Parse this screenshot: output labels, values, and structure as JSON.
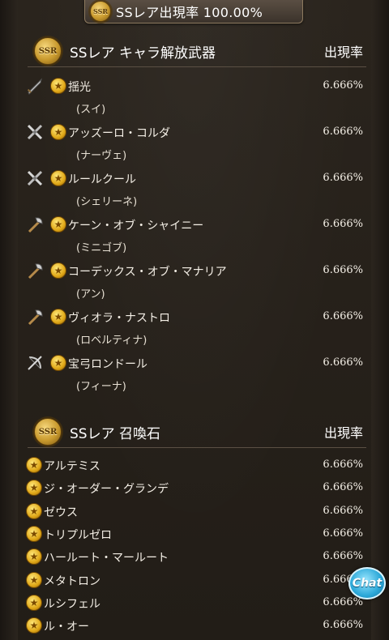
{
  "banner": {
    "badge": "SSR",
    "title": "SSレア出現率 100.00%"
  },
  "weapons_section": {
    "badge": "SSR",
    "title": "SSレア キャラ解放武器",
    "rate_header": "出現率",
    "items": [
      {
        "name": "揺光",
        "character": "(スイ)",
        "rate": "6.666%",
        "icon": "sword-icon"
      },
      {
        "name": "アッズーロ・コルダ",
        "character": "(ナーヴェ)",
        "rate": "6.666%",
        "icon": "crossed-swords-icon"
      },
      {
        "name": "ルールクール",
        "character": "(シェリーネ)",
        "rate": "6.666%",
        "icon": "crossed-swords-icon"
      },
      {
        "name": "ケーン・オブ・シャイニー",
        "character": "(ミニゴブ)",
        "rate": "6.666%",
        "icon": "axe-icon"
      },
      {
        "name": "コーデックス・オブ・マナリア",
        "character": "(アン)",
        "rate": "6.666%",
        "icon": "axe-icon"
      },
      {
        "name": "ヴィオラ・ナストロ",
        "character": "(ロベルティナ)",
        "rate": "6.666%",
        "icon": "axe-icon"
      },
      {
        "name": "宝弓ロンドール",
        "character": "(フィーナ)",
        "rate": "6.666%",
        "icon": "bow-icon"
      }
    ]
  },
  "summon_section": {
    "badge": "SSR",
    "title": "SSレア 召喚石",
    "rate_header": "出現率",
    "items": [
      {
        "name": "アルテミス",
        "rate": "6.666%"
      },
      {
        "name": "ジ・オーダー・グランデ",
        "rate": "6.666%"
      },
      {
        "name": "ゼウス",
        "rate": "6.666%"
      },
      {
        "name": "トリプルゼロ",
        "rate": "6.666%"
      },
      {
        "name": "ハールート・マールート",
        "rate": "6.666%"
      },
      {
        "name": "メタトロン",
        "rate": "6.666%"
      },
      {
        "name": "ルシフェル",
        "rate": "6.666%"
      },
      {
        "name": "ル・オー",
        "rate": "6.666%"
      }
    ]
  },
  "chat_button": {
    "label": "Chat"
  },
  "colors": {
    "background": "#26211b",
    "text": "#f4efe6",
    "gold": "#e0a818",
    "chat": "#2aa7d8"
  }
}
